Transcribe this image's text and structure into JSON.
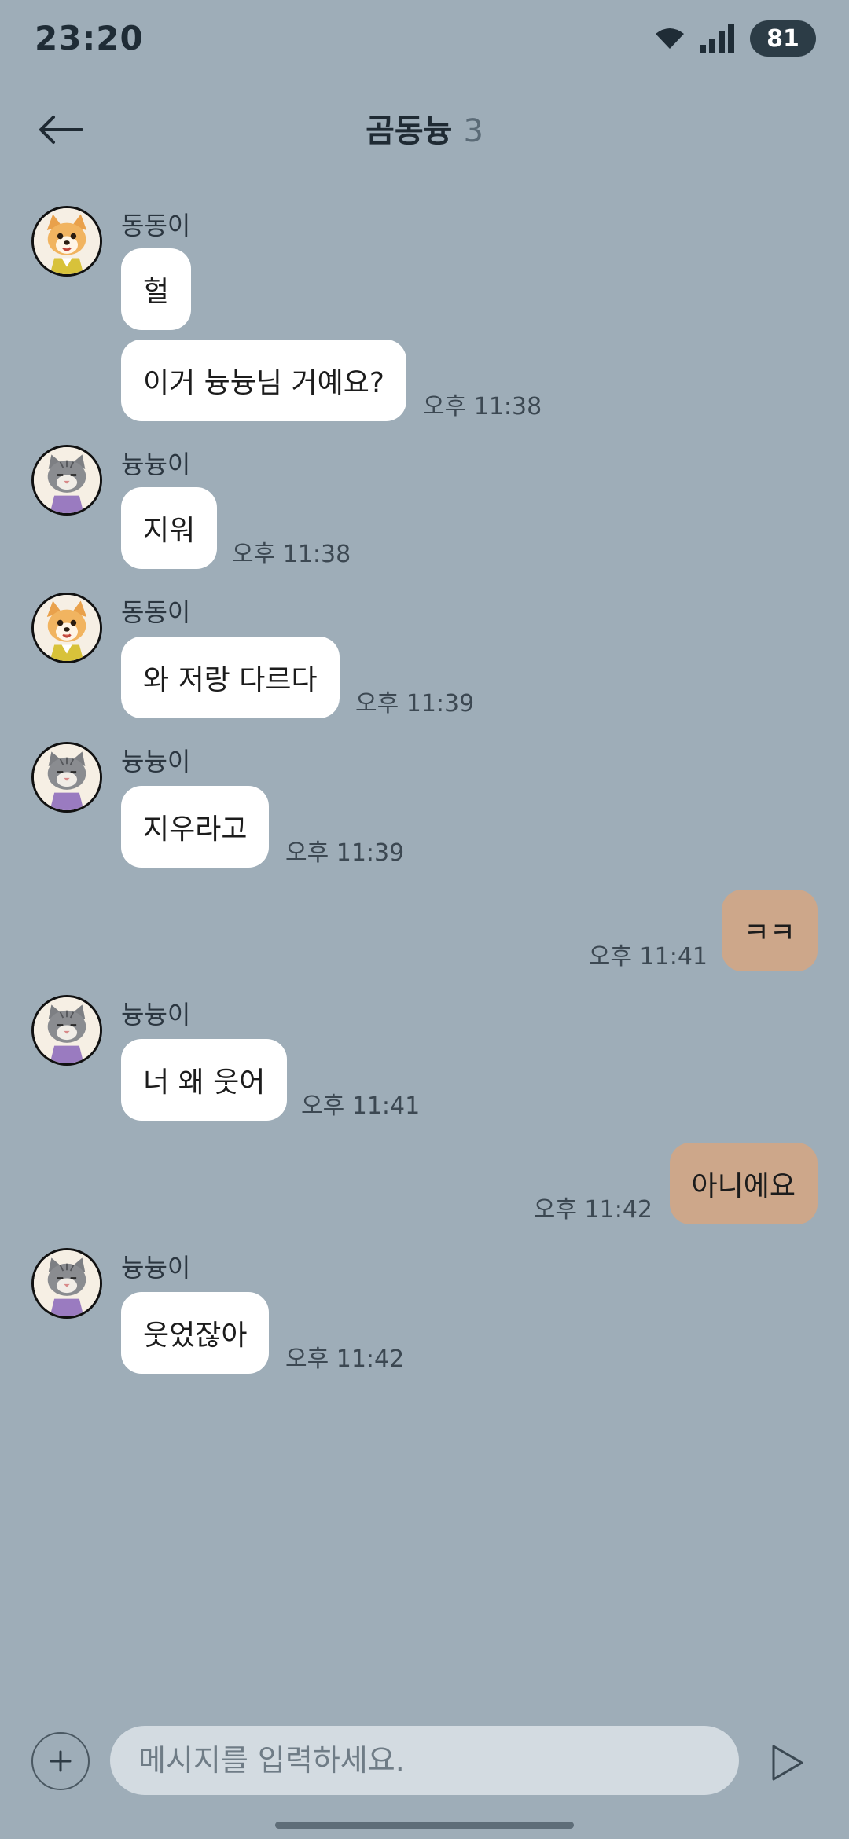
{
  "status": {
    "time": "23:20",
    "battery": "81"
  },
  "header": {
    "title": "곰동늉",
    "member_count": "3"
  },
  "users": {
    "dog": "동동이",
    "cat": "늉늉이"
  },
  "messages": [
    {
      "text": "헐"
    },
    {
      "text": "이거 늉늉님 거예요?",
      "time": "오후 11:38"
    },
    {
      "text": "지워",
      "time": "오후 11:38"
    },
    {
      "text": "와 저랑 다르다",
      "time": "오후 11:39"
    },
    {
      "text": "지우라고",
      "time": "오후 11:39"
    },
    {
      "text": "ㅋㅋ",
      "time": "오후 11:41"
    },
    {
      "text": "너 왜 웃어",
      "time": "오후 11:41"
    },
    {
      "text": "아니에요",
      "time": "오후 11:42"
    },
    {
      "text": "웃었잖아",
      "time": "오후 11:42"
    }
  ],
  "input": {
    "placeholder": "메시지를 입력하세요."
  },
  "icons": {
    "back": "arrow-left-icon",
    "wifi": "wifi-icon",
    "signal": "signal-icon",
    "plus": "plus-icon",
    "send": "send-icon"
  },
  "colors": {
    "background": "#9eadb8",
    "incoming_bubble": "#ffffff",
    "outgoing_bubble": "#cda78a",
    "input_background": "#d3dbe1"
  }
}
